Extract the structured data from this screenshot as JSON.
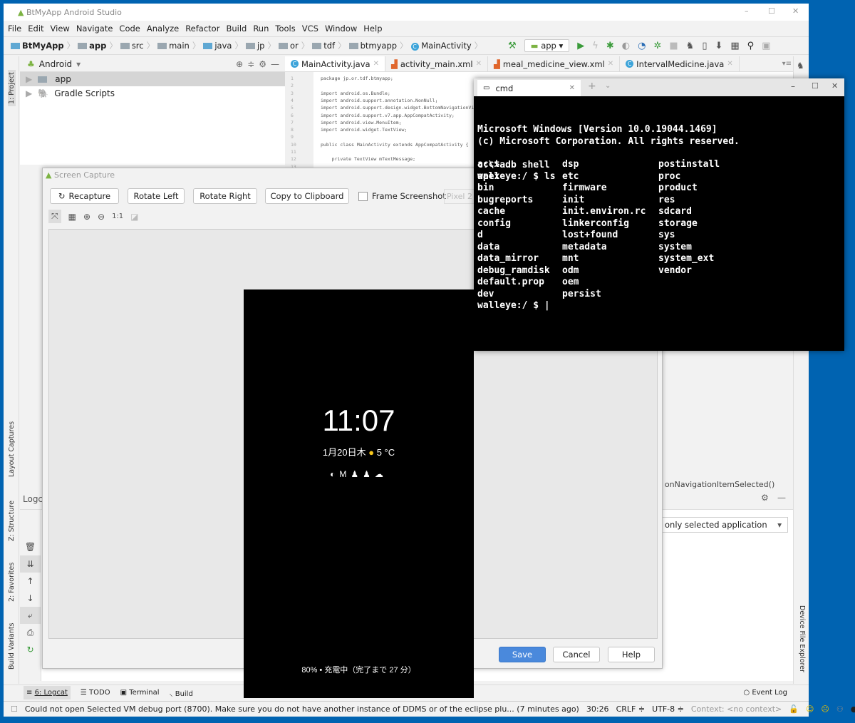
{
  "window": {
    "title": "BtMyApp Android Studio",
    "controls": [
      "–",
      "☐",
      "✕"
    ]
  },
  "menu": [
    "File",
    "Edit",
    "View",
    "Navigate",
    "Code",
    "Analyze",
    "Refactor",
    "Build",
    "Run",
    "Tools",
    "VCS",
    "Window",
    "Help"
  ],
  "breadcrumb": [
    "BtMyApp",
    "app",
    "src",
    "main",
    "java",
    "jp",
    "or",
    "tdf",
    "btmyapp",
    "MainActivity"
  ],
  "run_config": "app",
  "project": {
    "view": "Android",
    "items": [
      "app",
      "Gradle Scripts"
    ]
  },
  "left_stripe": [
    "1: Project",
    "Layout Captures",
    "Z: Structure",
    "2: Favorites",
    "Build Variants"
  ],
  "right_stripe": [
    "Device File Explorer"
  ],
  "editor_tabs": [
    {
      "label": "MainActivity.java",
      "active": true
    },
    {
      "label": "activity_main.xml"
    },
    {
      "label": "meal_medicine_view.xml"
    },
    {
      "label": "IntervalMedicine.java"
    }
  ],
  "code": {
    "lines": [
      "package jp.or.tdf.btmyapp;",
      "",
      "import android.os.Bundle;",
      "import android.support.annotation.NonNull;",
      "import android.support.design.widget.BottomNavigationView;",
      "import android.support.v7.app.AppCompatActivity;",
      "import android.view.MenuItem;",
      "import android.widget.TextView;",
      "",
      "public class MainActivity extends AppCompatActivity {",
      "",
      "    private TextView mTextMessage;",
      ""
    ],
    "line_numbers": [
      "1",
      "2",
      "3",
      "4",
      "5",
      "6",
      "7",
      "8",
      "9",
      "10",
      "11",
      "12",
      "13"
    ]
  },
  "editor_breadcrumb": "onNavigationItemSelected()",
  "logcat": {
    "label": "Logca",
    "filter": "only selected application"
  },
  "bottom_tabs": [
    "6: Logcat",
    "TODO",
    "Terminal",
    "Build",
    "Event Log"
  ],
  "status": {
    "message": "Could not open Selected VM debug port (8700). Make sure you do not have another instance of DDMS or of the eclipse plu... (7 minutes ago)",
    "position": "30:26",
    "line_sep": "CRLF ≑",
    "encoding": "UTF-8 ≑",
    "context": "Context: <no context>"
  },
  "dialog": {
    "title": "Screen Capture",
    "buttons": {
      "recapture": "Recapture",
      "rotate_left": "Rotate Left",
      "rotate_right": "Rotate Right",
      "copy": "Copy to Clipboard",
      "save": "Save",
      "cancel": "Cancel",
      "help": "Help"
    },
    "frame_label": "Frame Screenshot",
    "frame_checked": false,
    "device": "Pixel 2",
    "zoom_actual": "1:1"
  },
  "phone": {
    "time": "11:07",
    "date": "1月20日木",
    "temp": "5 °C",
    "battery": "80% • 充電中（完了まで 27 分）"
  },
  "cmd": {
    "tab": "cmd",
    "header": [
      "Microsoft Windows [Version 10.0.19044.1469]",
      "(c) Microsoft Corporation. All rights reserved.",
      "",
      "c:\\>adb shell",
      "walleye:/ $ ls"
    ],
    "columns": [
      [
        "acct",
        "apex",
        "bin",
        "bugreports",
        "cache",
        "config",
        "d",
        "data",
        "data_mirror",
        "debug_ramdisk",
        "default.prop",
        "dev"
      ],
      [
        "dsp",
        "etc",
        "firmware",
        "init",
        "init.environ.rc",
        "linkerconfig",
        "lost+found",
        "metadata",
        "mnt",
        "odm",
        "oem",
        "persist"
      ],
      [
        "postinstall",
        "proc",
        "product",
        "res",
        "sdcard",
        "storage",
        "sys",
        "system",
        "system_ext",
        "vendor"
      ]
    ],
    "prompt": "walleye:/ $ |"
  },
  "colors": {
    "desktop": "#0063b1",
    "accent": "#4a89dc",
    "terminal_bg": "#000000"
  }
}
